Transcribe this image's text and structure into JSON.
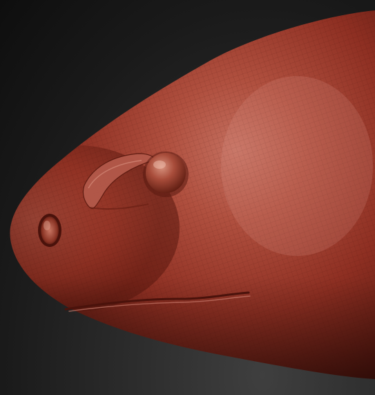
{
  "scene": {
    "subject": "",
    "material_color": "#9b3a2c",
    "highlight_color": "#c87a6c",
    "shadow_color": "#3a0f0a",
    "background_color": "#1c1c1c",
    "wireframe_visible": true
  }
}
